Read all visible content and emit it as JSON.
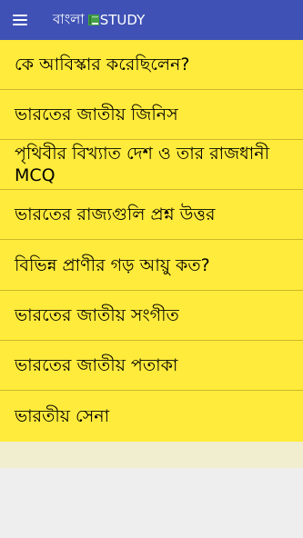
{
  "app_bar": {
    "title_prefix": "বাংলা",
    "title_suffix": "STUDY",
    "menu_icon": "hamburger-menu-icon",
    "title_icon": "book-icon",
    "color": "#3f51b5"
  },
  "list": {
    "background": "#ffeb3b",
    "items": [
      {
        "label": "কে আবিস্কার করেছিলেন?"
      },
      {
        "label": "ভারতের জাতীয় জিনিস"
      },
      {
        "label": "পৃথিবীর বিখ্যাত দেশ ও তার রাজধানী MCQ"
      },
      {
        "label": "ভারতের রাজ্যগুলি প্রশ্ন উত্তর"
      },
      {
        "label": "বিভিন্ন প্রাণীর গড় আয়ু কত?"
      },
      {
        "label": "ভারতের জাতীয় সংগীত"
      },
      {
        "label": "ভারতের জাতীয় পতাকা"
      },
      {
        "label": "ভারতীয় সেনা"
      }
    ]
  }
}
